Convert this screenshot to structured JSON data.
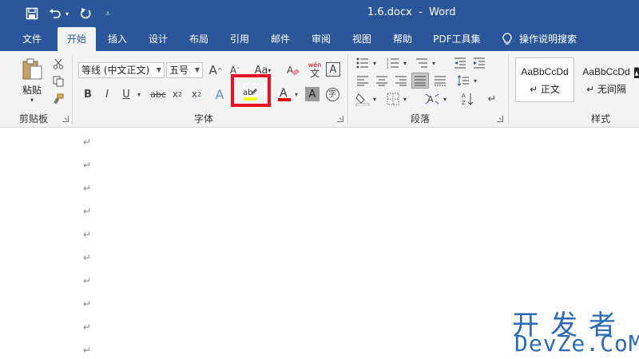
{
  "window": {
    "title": "1.6.docx  -  Word"
  },
  "tabs": [
    "文件",
    "开始",
    "插入",
    "设计",
    "布局",
    "引用",
    "邮件",
    "审阅",
    "视图",
    "帮助",
    "PDF工具集"
  ],
  "tell_me": "操作说明搜索",
  "clipboard": {
    "paste_label": "粘贴",
    "group_label": "剪贴板"
  },
  "font": {
    "name": "等线 (中文正文)",
    "size": "五号",
    "group_label": "字体",
    "phonetic_top": "wén",
    "phonetic_bottom": "文",
    "enclosed_char": "字",
    "highlight_color": "#ffff00",
    "font_color": "#e00000"
  },
  "paragraph": {
    "group_label": "段落"
  },
  "styles": {
    "group_label": "样式",
    "items": [
      {
        "sample": "AaBbCcDd",
        "name": "↵ 正文"
      },
      {
        "sample": "AaBbCcDd",
        "name": "↵ 无间隔"
      }
    ]
  },
  "document": {
    "paragraph_mark": "↵"
  },
  "watermark": {
    "cn": "开发者",
    "en": "DevZe.CoM"
  },
  "colors": {
    "accent": "#2b579a",
    "highlight_box": "#e81123"
  }
}
